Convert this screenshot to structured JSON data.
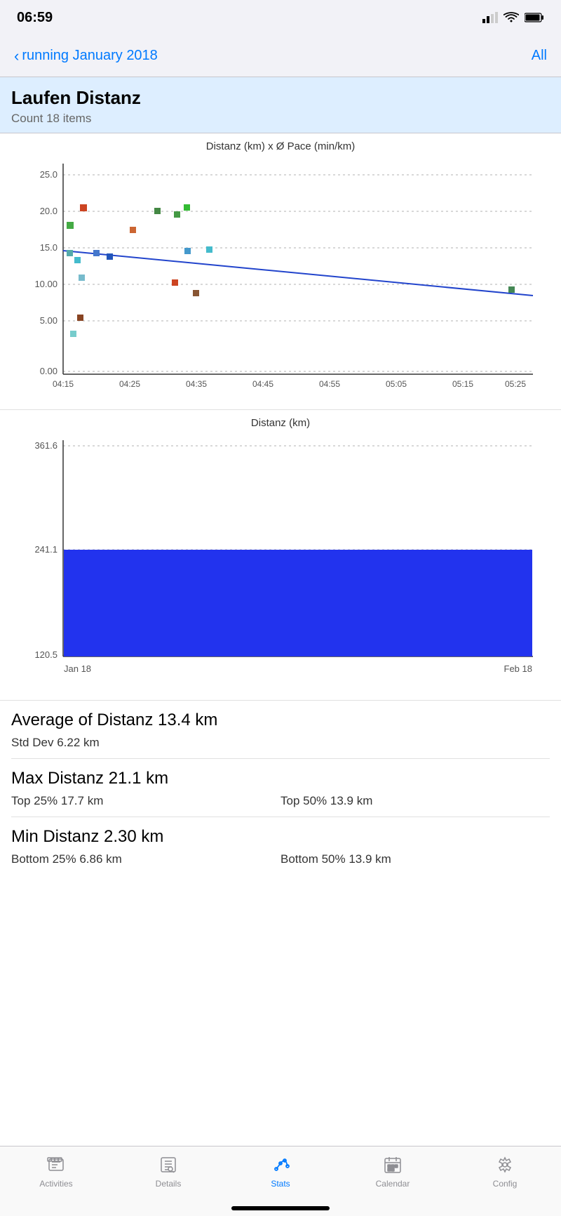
{
  "statusBar": {
    "time": "06:59",
    "signal": "●●▪▪",
    "wifi": "wifi",
    "battery": "battery"
  },
  "navBar": {
    "backText": "running January 2018",
    "rightText": "All"
  },
  "pageHeader": {
    "title": "Laufen Distanz",
    "subtitle": "Count 18 items"
  },
  "scatterChart": {
    "title": "Distanz (km) x Ø Pace (min/km)",
    "yAxisLabels": [
      "25.0",
      "20.0",
      "15.0",
      "10.00",
      "5.00",
      "0.00"
    ],
    "xAxisLabels": [
      "04:15",
      "04:25",
      "04:35",
      "04:45",
      "04:55",
      "05:05",
      "05:15",
      "05:25"
    ]
  },
  "barChart": {
    "title": "Distanz (km)",
    "yAxisLabels": [
      "361.6",
      "241.1",
      "120.5"
    ],
    "xAxisLabels": [
      "Jan 18",
      "Feb 18"
    ]
  },
  "stats": [
    {
      "type": "large",
      "label": "Average of Distanz 13.4 km"
    },
    {
      "type": "small",
      "items": [
        "Std Dev 6.22 km",
        ""
      ]
    },
    {
      "type": "divider"
    },
    {
      "type": "large",
      "label": "Max Distanz 21.1 km"
    },
    {
      "type": "small",
      "items": [
        "Top 25% 17.7 km",
        "Top 50% 13.9 km"
      ]
    },
    {
      "type": "divider"
    },
    {
      "type": "large",
      "label": "Min Distanz 2.30 km"
    },
    {
      "type": "small",
      "items": [
        "Bottom 25% 6.86 km",
        "Bottom 50% 13.9 km"
      ]
    }
  ],
  "tabBar": {
    "items": [
      {
        "id": "activities",
        "label": "Activities",
        "active": false
      },
      {
        "id": "details",
        "label": "Details",
        "active": false
      },
      {
        "id": "stats",
        "label": "Stats",
        "active": true
      },
      {
        "id": "calendar",
        "label": "Calendar",
        "active": false
      },
      {
        "id": "config",
        "label": "Config",
        "active": false
      }
    ]
  }
}
